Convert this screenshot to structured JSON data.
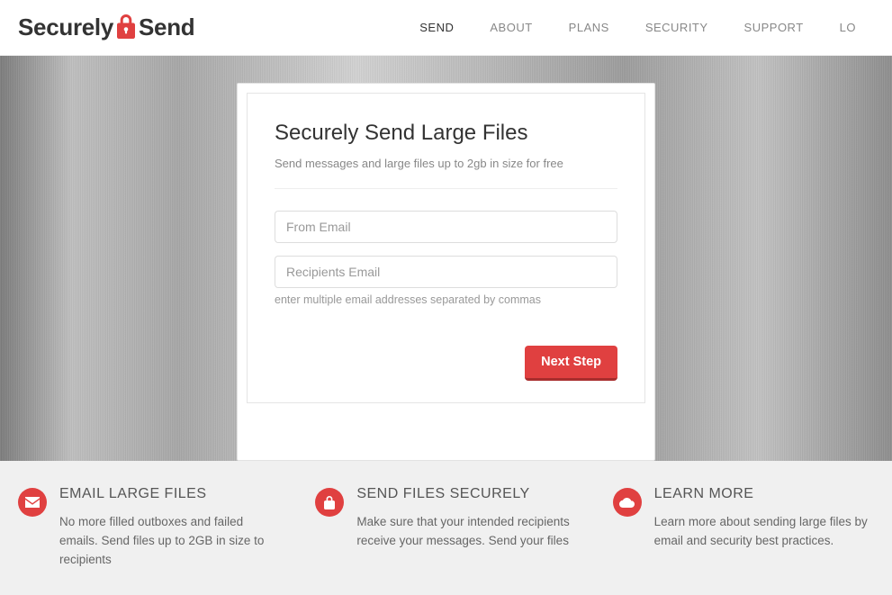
{
  "logo": {
    "part1": "Securely",
    "part2": "Send"
  },
  "nav": {
    "items": [
      {
        "label": "SEND",
        "active": true
      },
      {
        "label": "ABOUT",
        "active": false
      },
      {
        "label": "PLANS",
        "active": false
      },
      {
        "label": "SECURITY",
        "active": false
      },
      {
        "label": "SUPPORT",
        "active": false
      },
      {
        "label": "LO",
        "active": false
      }
    ]
  },
  "form": {
    "title": "Securely Send Large Files",
    "subtitle": "Send messages and large files up to 2gb in size for free",
    "from_placeholder": "From Email",
    "recipients_placeholder": "Recipients Email",
    "helper": "enter multiple email addresses separated by commas",
    "next_label": "Next Step"
  },
  "features": [
    {
      "icon": "envelope-icon",
      "title": "EMAIL LARGE FILES",
      "body": "No more filled outboxes and failed emails. Send files up to 2GB in size to recipients"
    },
    {
      "icon": "lock-icon",
      "title": "SEND FILES SECURELY",
      "body": "Make sure that your intended recipients receive your messages. Send your files"
    },
    {
      "icon": "cloud-icon",
      "title": "LEARN MORE",
      "body": "Learn more about sending large files by email and security best practices."
    }
  ],
  "colors": {
    "accent": "#e04040"
  }
}
